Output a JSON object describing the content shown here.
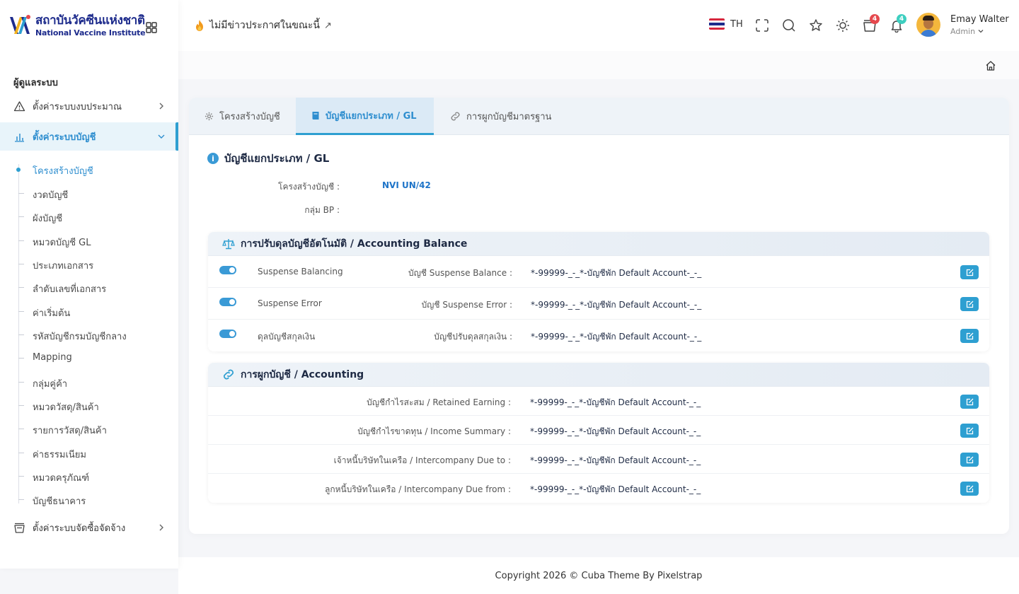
{
  "brand": {
    "name_th": "สถาบันวัคซีนแห่งชาติ",
    "name_en": "National Vaccine Institute"
  },
  "sidebar": {
    "heading": "ผู้ดูแลระบบ",
    "items": [
      {
        "label": "ตั้งค่าระบบงบประมาณ",
        "icon": "warning-triangle-icon",
        "expanded": false
      },
      {
        "label": "ตั้งค่าระบบบัญชี",
        "icon": "bar-chart-icon",
        "expanded": true
      },
      {
        "label": "ตั้งค่าระบบจัดซื้อจัดจ้าง",
        "icon": "basket-icon",
        "expanded": false
      }
    ],
    "subitems": [
      "โครงสร้างบัญชี",
      "งวดบัญชี",
      "ผังบัญชี",
      "หมวดบัญชี GL",
      "ประเภทเอกสาร",
      "ลำดับเลขที่เอกสาร",
      "ค่าเริ่มต้น",
      "รหัสบัญชีกรมบัญชีกลาง",
      "Mapping",
      "กลุ่มคู่ค้า",
      "หมวดวัสดุ/สินค้า",
      "รายการวัสดุ/สินค้า",
      "ค่าธรรมเนียม",
      "หมวดครุภัณฑ์",
      "บัญชีธนาคาร"
    ]
  },
  "header": {
    "news": "ไม่มีข่าวประกาศในขณะนี้",
    "news_arrow": "↗",
    "lang": "TH",
    "cart_count": "4",
    "notif_count": "4",
    "user_name": "Emay Walter",
    "user_role": "Admin",
    "colors": {
      "cart_badge": "#e5484d",
      "notif_badge": "#3ecfc0"
    }
  },
  "tabs": [
    {
      "label": "โครงสร้างบัญชี",
      "icon": "gear-icon"
    },
    {
      "label": "บัญชีแยกประเภท / GL",
      "icon": "book-icon"
    },
    {
      "label": "การผูกบัญชีมาตรฐาน",
      "icon": "link-icon"
    }
  ],
  "section": {
    "title": "บัญชีแยกประเภท / GL",
    "structure_label": "โครงสร้างบัญชี :",
    "structure_value": "NVI UN/42",
    "bp_label": "กลุ่ม BP :",
    "bp_value": ""
  },
  "balance": {
    "title": "การปรับดุลบัญชีอัตโนมัติ / Accounting Balance",
    "rows": [
      {
        "name": "Suspense Balancing",
        "label": "บัญชี Suspense Balance :",
        "value": "*-99999-_-_*-บัญชีพัก Default Account-_-_",
        "enabled": true
      },
      {
        "name": "Suspense Error",
        "label": "บัญชี Suspense Error :",
        "value": "*-99999-_-_*-บัญชีพัก Default Account-_-_",
        "enabled": true
      },
      {
        "name": "ดุลบัญชีสกุลเงิน",
        "label": "บัญชีปรับดุลสกุลเงิน :",
        "value": "*-99999-_-_*-บัญชีพัก Default Account-_-_",
        "enabled": true
      }
    ]
  },
  "accounting": {
    "title": "การผูกบัญชี / Accounting",
    "rows": [
      {
        "label": "บัญชีกำไรสะสม / Retained Earning :",
        "value": "*-99999-_-_*-บัญชีพัก Default Account-_-_"
      },
      {
        "label": "บัญชีกำไรขาดทุน / Income Summary :",
        "value": "*-99999-_-_*-บัญชีพัก Default Account-_-_"
      },
      {
        "label": "เจ้าหนี้บริษัทในเครือ / Intercompany Due to :",
        "value": "*-99999-_-_*-บัญชีพัก Default Account-_-_"
      },
      {
        "label": "ลูกหนี้บริษัทในเครือ / Intercompany Due from :",
        "value": "*-99999-_-_*-บัญชีพัก Default Account-_-_"
      }
    ]
  },
  "footer": {
    "text": "Copyright 2026 © Cuba Theme By Pixelstrap"
  },
  "colors": {
    "accent": "#2e9fd1",
    "link": "#1e74c8",
    "brand_navy": "#1d2b8c"
  }
}
